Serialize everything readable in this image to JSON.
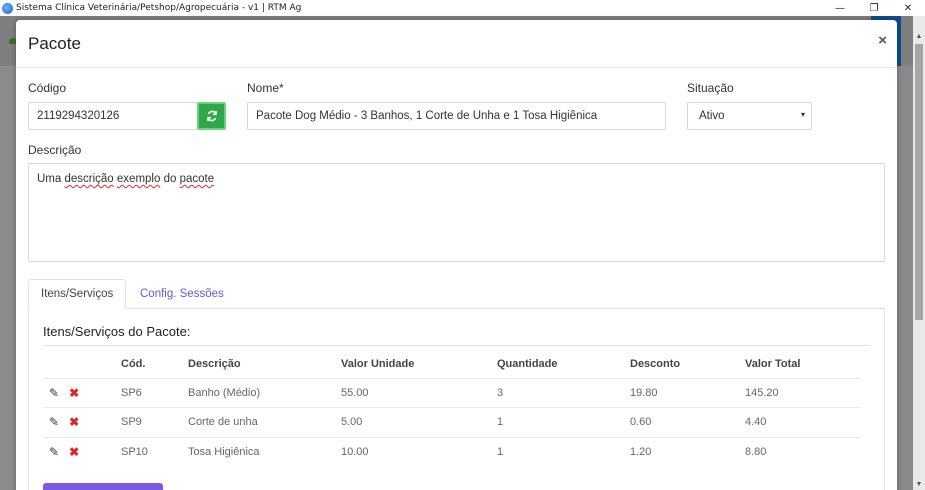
{
  "window": {
    "title": "Sistema Clínica Veterinária/Petshop/Agropecuária - v1 | RTM Ag",
    "controls": {
      "minimize": "—",
      "maximize": "❐",
      "close": "✕"
    }
  },
  "modal": {
    "title": "Pacote",
    "close_label": "×",
    "fields": {
      "codigo": {
        "label": "Código",
        "value": "2119294320126"
      },
      "nome": {
        "label": "Nome*",
        "value": "Pacote Dog Médio - 3 Banhos, 1 Corte de Unha e 1 Tosa Higiênica"
      },
      "situacao": {
        "label": "Situação",
        "value": "Ativo",
        "options": [
          "Ativo"
        ]
      },
      "descricao": {
        "label": "Descrição",
        "value_parts": [
          "Uma ",
          "descrição",
          " ",
          "exemplo",
          " do ",
          "pacote"
        ]
      }
    },
    "tabs": [
      {
        "label": "Itens/Serviços",
        "active": true
      },
      {
        "label": "Config. Sessões",
        "active": false
      }
    ],
    "items_panel": {
      "title": "Itens/Serviços do Pacote:",
      "columns": [
        "Cód.",
        "Descrição",
        "Valor Unidade",
        "Quantidade",
        "Desconto",
        "Valor Total"
      ],
      "rows": [
        {
          "cod": "SP6",
          "descricao": "Banho (Médio)",
          "valor_unidade": "55.00",
          "quantidade": "3",
          "desconto": "19.80",
          "valor_total": "145.20"
        },
        {
          "cod": "SP9",
          "descricao": "Corte de unha",
          "valor_unidade": "5.00",
          "quantidade": "1",
          "desconto": "0.60",
          "valor_total": "4.40"
        },
        {
          "cod": "SP10",
          "descricao": "Tosa Higiênica",
          "valor_unidade": "10.00",
          "quantidade": "1",
          "desconto": "1.20",
          "valor_total": "8.80"
        }
      ],
      "row_actions": {
        "edit_icon": "pencil-icon",
        "delete_icon": "x-icon"
      }
    }
  },
  "colors": {
    "refresh_button": "#2ea84a",
    "tab_link": "#5b5bd6",
    "delete": "#e0242e",
    "primary_button": "#7a5ce6"
  }
}
